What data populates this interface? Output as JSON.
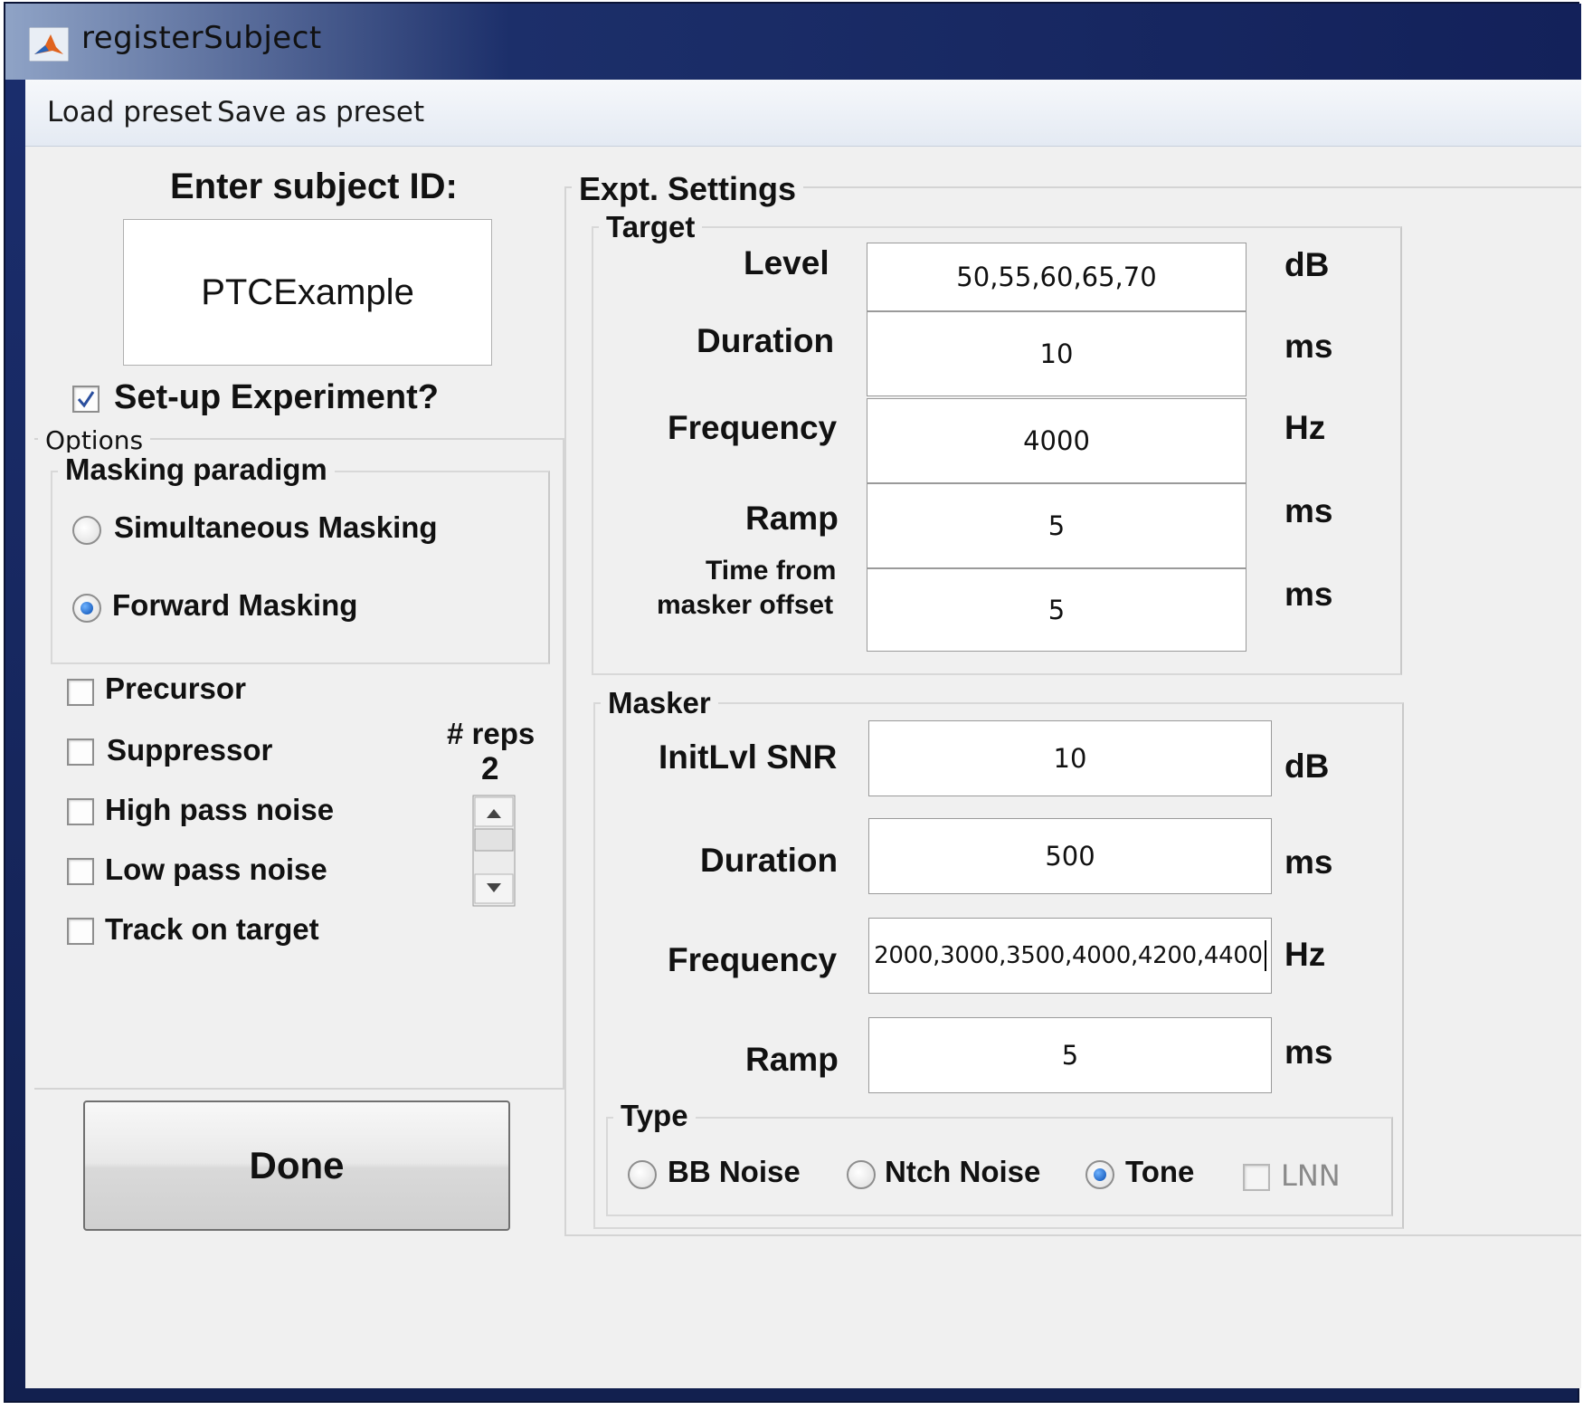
{
  "window": {
    "title": "registerSubject"
  },
  "menu": {
    "load_preset": "Load preset",
    "save_preset": "Save as preset"
  },
  "subject": {
    "heading": "Enter subject ID:",
    "value": "PTCExample",
    "setup_label": "Set-up Experiment?",
    "setup_checked": true
  },
  "options": {
    "title": "Options",
    "masking": {
      "title": "Masking paradigm",
      "simultaneous": "Simultaneous Masking",
      "forward": "Forward Masking",
      "selected": "forward"
    },
    "checks": {
      "precursor": "Precursor",
      "suppressor": "Suppressor",
      "high_pass": "High pass noise",
      "low_pass": "Low pass noise",
      "track": "Track on target"
    },
    "reps": {
      "label": "# reps",
      "value": "2"
    }
  },
  "done_label": "Done",
  "expt": {
    "title": "Expt. Settings",
    "target": {
      "title": "Target",
      "level": {
        "label": "Level",
        "value": "50,55,60,65,70",
        "unit": "dB"
      },
      "duration": {
        "label": "Duration",
        "value": "10",
        "unit": "ms"
      },
      "frequency": {
        "label": "Frequency",
        "value": "4000",
        "unit": "Hz"
      },
      "ramp": {
        "label": "Ramp",
        "value": "5",
        "unit": "ms"
      },
      "time_offset": {
        "label_line1": "Time from",
        "label_line2": "masker offset",
        "value": "5",
        "unit": "ms"
      }
    },
    "masker": {
      "title": "Masker",
      "initlvl": {
        "label": "InitLvl SNR",
        "value": "10",
        "unit": "dB"
      },
      "duration": {
        "label": "Duration",
        "value": "500",
        "unit": "ms"
      },
      "frequency": {
        "label": "Frequency",
        "value": "2000,3000,3500,4000,4200,4400",
        "unit": "Hz"
      },
      "ramp": {
        "label": "Ramp",
        "value": "5",
        "unit": "ms"
      },
      "type": {
        "title": "Type",
        "bb": "BB Noise",
        "ntch": "Ntch Noise",
        "tone": "Tone",
        "lnn": "LNN",
        "selected": "tone"
      }
    }
  }
}
